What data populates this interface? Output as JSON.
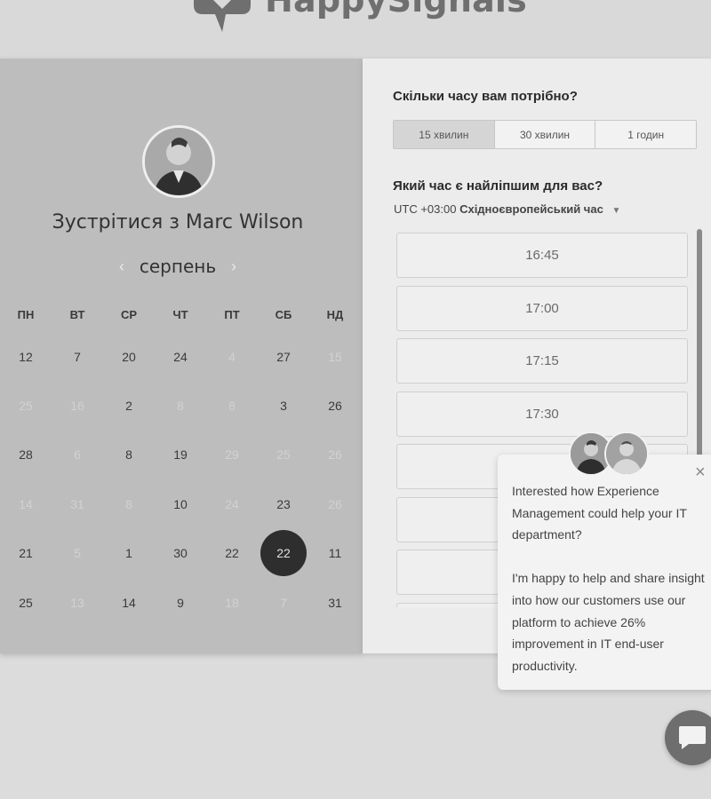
{
  "brand": {
    "name": "HappySignals",
    "icon": "speech-heart-logo-icon"
  },
  "calendar": {
    "title": "Зустрітися з Marc Wilson",
    "host_avatar": "host-avatar",
    "month": "серпень",
    "prev_icon": "chevron-left-icon",
    "next_icon": "chevron-right-icon",
    "weekdays": [
      "ПН",
      "ВТ",
      "СР",
      "ЧТ",
      "ПТ",
      "СБ",
      "НД"
    ],
    "weeks": [
      [
        {
          "d": "12",
          "dim": false
        },
        {
          "d": "7",
          "dim": false
        },
        {
          "d": "20",
          "dim": false
        },
        {
          "d": "24",
          "dim": false
        },
        {
          "d": "4",
          "dim": true
        },
        {
          "d": "27",
          "dim": false
        },
        {
          "d": "15",
          "dim": true
        }
      ],
      [
        {
          "d": "25",
          "dim": true
        },
        {
          "d": "16",
          "dim": true
        },
        {
          "d": "2",
          "dim": false
        },
        {
          "d": "8",
          "dim": true
        },
        {
          "d": "8",
          "dim": true
        },
        {
          "d": "3",
          "dim": false
        },
        {
          "d": "26",
          "dim": false
        }
      ],
      [
        {
          "d": "28",
          "dim": false
        },
        {
          "d": "6",
          "dim": true
        },
        {
          "d": "8",
          "dim": false
        },
        {
          "d": "19",
          "dim": false
        },
        {
          "d": "29",
          "dim": true
        },
        {
          "d": "25",
          "dim": true
        },
        {
          "d": "26",
          "dim": true
        }
      ],
      [
        {
          "d": "14",
          "dim": true
        },
        {
          "d": "31",
          "dim": true
        },
        {
          "d": "8",
          "dim": true
        },
        {
          "d": "10",
          "dim": false
        },
        {
          "d": "24",
          "dim": true
        },
        {
          "d": "23",
          "dim": false
        },
        {
          "d": "26",
          "dim": true
        }
      ],
      [
        {
          "d": "21",
          "dim": false
        },
        {
          "d": "5",
          "dim": true
        },
        {
          "d": "1",
          "dim": false
        },
        {
          "d": "30",
          "dim": false
        },
        {
          "d": "22",
          "dim": false
        },
        {
          "d": "22",
          "dim": false,
          "selected": true
        },
        {
          "d": "11",
          "dim": false
        }
      ],
      [
        {
          "d": "25",
          "dim": false
        },
        {
          "d": "13",
          "dim": true
        },
        {
          "d": "14",
          "dim": false
        },
        {
          "d": "9",
          "dim": false
        },
        {
          "d": "18",
          "dim": true
        },
        {
          "d": "7",
          "dim": true
        },
        {
          "d": "31",
          "dim": false
        }
      ]
    ]
  },
  "booking": {
    "duration_question": "Скільки часу вам потрібно?",
    "durations": [
      {
        "label": "15 хвилин",
        "active": true
      },
      {
        "label": "30 хвилин",
        "active": false
      },
      {
        "label": "1 годин",
        "active": false
      }
    ],
    "time_question": "Який час є найліпшим для вас?",
    "timezone_offset": "UTC +03:00",
    "timezone_name": "Східноєвропейський час",
    "timezone_caret": "caret-down-icon",
    "slots": [
      "16:45",
      "17:00",
      "17:15",
      "17:30",
      "",
      "",
      "",
      ""
    ]
  },
  "chat": {
    "close_label": "×",
    "message_1": "Interested how Experience Management could help your IT department?",
    "message_2": "I'm happy to help and share insight into how our customers use our platform to achieve 26% improvement in IT end-user productivity.",
    "launcher_icon": "chat-bubble-icon"
  }
}
